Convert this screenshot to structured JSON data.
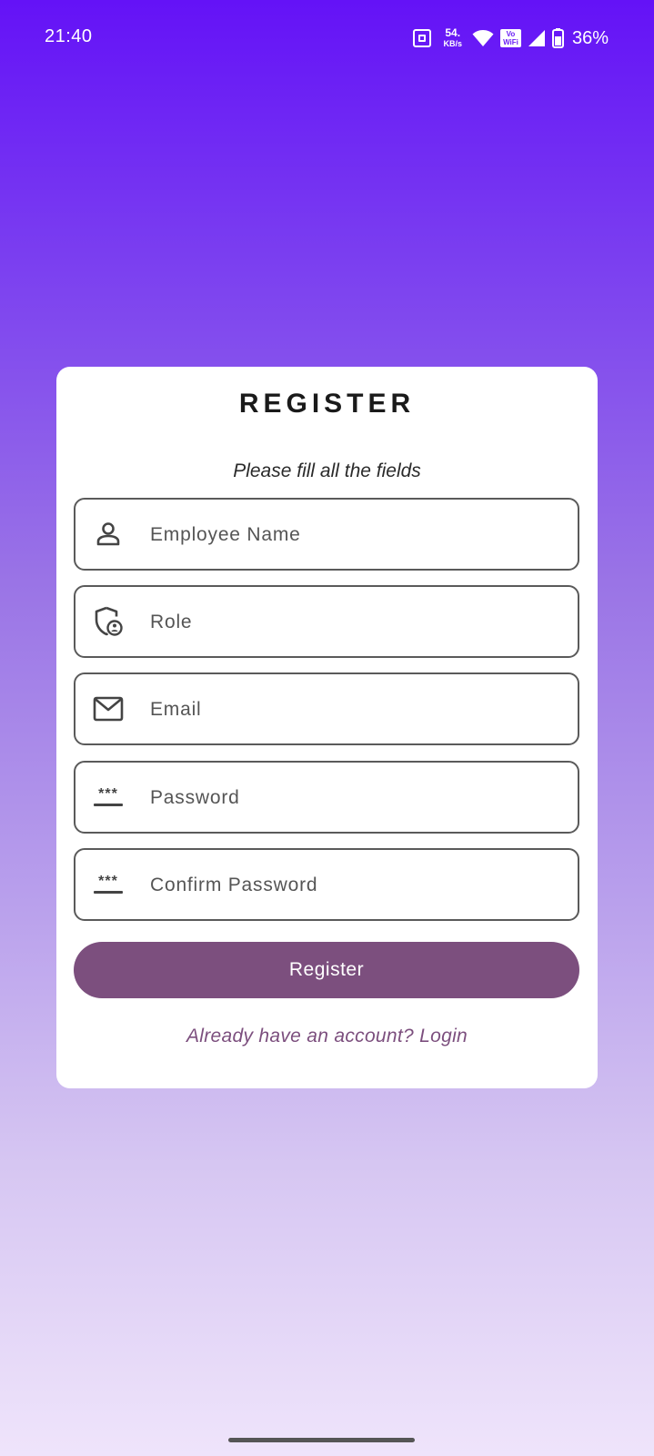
{
  "status_bar": {
    "time": "21:40",
    "net_speed_value": "54.",
    "net_speed_unit": "KB/s",
    "vowifi_line1": "Vo",
    "vowifi_line2": "WiFi",
    "battery_percent": "36%",
    "icons": [
      "nfc-icon",
      "wifi-icon",
      "vowifi-icon",
      "signal-icon",
      "battery-icon"
    ]
  },
  "form": {
    "title": "REGISTER",
    "subtitle": "Please fill all the fields",
    "fields": [
      {
        "icon": "person-icon",
        "placeholder": "Employee Name",
        "value": ""
      },
      {
        "icon": "shield-user-icon",
        "placeholder": "Role",
        "value": ""
      },
      {
        "icon": "mail-icon",
        "placeholder": "Email",
        "value": ""
      },
      {
        "icon": "password-icon",
        "placeholder": "Password",
        "value": "",
        "icon_text": "***"
      },
      {
        "icon": "password-icon",
        "placeholder": "Confirm Password",
        "value": "",
        "icon_text": "***"
      }
    ],
    "submit_label": "Register",
    "login_link": "Already have an account? Login"
  },
  "colors": {
    "accent": "#7c4f7e",
    "gradient_top": "#6412f7",
    "gradient_bottom": "#efe4fb"
  }
}
